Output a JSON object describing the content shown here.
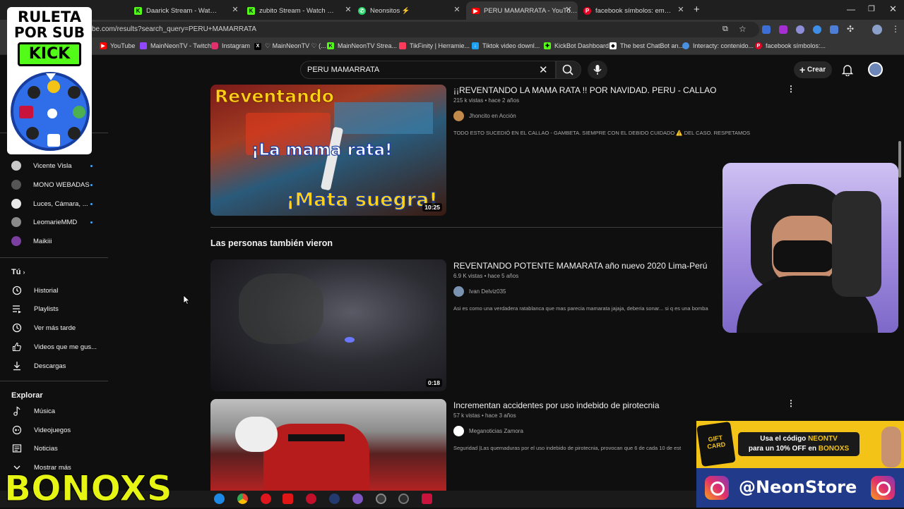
{
  "browser": {
    "tabs": [
      {
        "title": "Daarick Stream - Watch Live on",
        "icon": "kick-icon",
        "color": "#53fc18"
      },
      {
        "title": "zubito Stream - Watch Live on K",
        "icon": "kick-icon",
        "color": "#53fc18"
      },
      {
        "title": "Neonsitos ⚡",
        "icon": "whatsapp-icon",
        "color": "#25d366"
      },
      {
        "title": "PERU MAMARRATA - YouTube",
        "icon": "youtube-icon",
        "color": "#ff0000"
      },
      {
        "title": "facebook símbolos: emoticone",
        "icon": "pinterest-icon",
        "color": "#e60023"
      }
    ],
    "new_tab": "+",
    "url": "be.com/results?search_query=PERU+MAMARRATA",
    "bookmarks": [
      {
        "label": "YouTube",
        "color": "#ff0000"
      },
      {
        "label": "MainNeonTV - Twitch",
        "color": "#9146ff"
      },
      {
        "label": "Instagram",
        "color": "#e1306c"
      },
      {
        "label": "♡ MainNeonTV ♡ (...",
        "color": "#000000"
      },
      {
        "label": "MainNeonTV Strea...",
        "color": "#53fc18"
      },
      {
        "label": "TikFinity | Herramie...",
        "color": "#ff3b5c"
      },
      {
        "label": "Tiktok video downl...",
        "color": "#1da1f2"
      },
      {
        "label": "KickBot Dashboard",
        "color": "#53fc18"
      },
      {
        "label": "The best ChatBot an...",
        "color": "#ffffff"
      },
      {
        "label": "Interacty: contenido...",
        "color": "#4a90e2"
      },
      {
        "label": "facebook símbolos:...",
        "color": "#e60023"
      }
    ]
  },
  "youtube": {
    "search_value": "PERU MAMARRATA",
    "create_label": "Crear",
    "sidebar": {
      "subscriptions": [
        {
          "label": "Vicente Visla",
          "color": "#c9c9c9"
        },
        {
          "label": "MONO WEBADAS",
          "color": "#555555"
        },
        {
          "label": "Luces, Cámara, ...",
          "color": "#e8e8e8"
        },
        {
          "label": "LeomarieMMD",
          "color": "#8a8a8a"
        },
        {
          "label": "Maikiii",
          "color": "#7b3fa0"
        }
      ],
      "you_heading": "Tú",
      "you_items": [
        "Historial",
        "Playlists",
        "Ver más tarde",
        "Videos que me gus...",
        "Descargas"
      ],
      "explore_heading": "Explorar",
      "explore_items": [
        "Música",
        "Videojuegos",
        "Noticias",
        "Mostrar más"
      ]
    },
    "section_heading": "Las personas también vieron",
    "results": [
      {
        "title": "¡¡REVENTANDO LA MAMA RATA !! POR NAVIDAD. PERU - CALLAO",
        "meta": "215 k vistas • hace 2 años",
        "channel": "Jhoncito en Acción",
        "description": "TODO ESTO SUCEDIÓ EN EL CALLAO - GAMBETA. SIEMPRE CON EL DEBIDO CUIDADO ⚠️ DEL CASO. RESPETAMOS ...",
        "duration": "10:25",
        "thumb_texts": [
          "Reventando",
          "¡La mama rata!",
          "¡Mata suegra!"
        ]
      },
      {
        "title": "REVENTANDO POTENTE MAMARATA año nuevo 2020 Lima-Perú",
        "meta": "6.9 K vistas • hace 5 años",
        "channel": "Ivan Delviz035",
        "description": "Asi es como una verdadera ratablanca que mas parecia mamarata jajaja, deberia sonar... si q es una bomba",
        "duration": "0:18"
      },
      {
        "title": "Incrementan accidentes por uso indebido de pirotecnia",
        "meta": "57 k vistas • hace 3 años",
        "channel": "Meganoticias Zamora",
        "description": "Seguridad |Las quemaduras por el uso indebido de pirotecnia, provocan que 6 de cada 10 de est"
      }
    ]
  },
  "overlays": {
    "ruleta_lines": [
      "RULETA",
      "POR SUB",
      "KICK"
    ],
    "bonoxs_logo": "BONOXS",
    "promo_line1_prefix": "Usa el código ",
    "promo_code": "NEONTV",
    "promo_line2_prefix": "para un 10% OFF en ",
    "promo_brand": "BONOXS",
    "gift_card": "GIFT CARD",
    "instagram_handle": "@NeonStore"
  }
}
